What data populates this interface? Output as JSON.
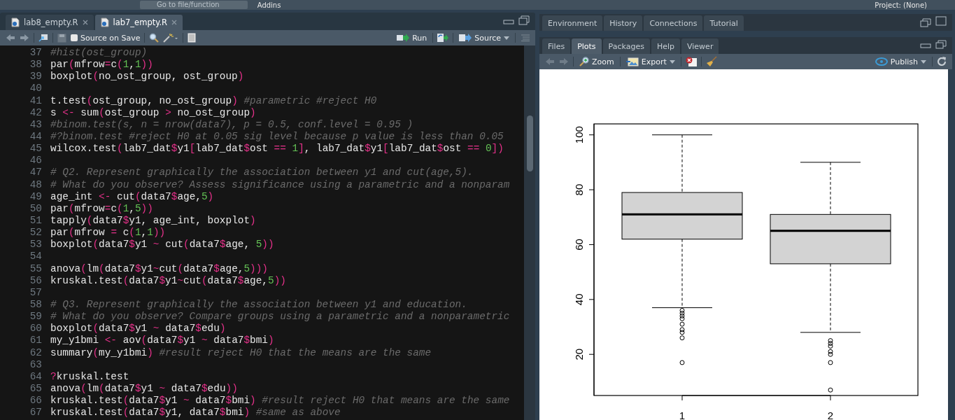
{
  "topbar": {
    "goto_placeholder": "Go to file/function",
    "addins": "Addins",
    "project": "Project: (None)"
  },
  "editor": {
    "tabs": [
      {
        "label": "lab8_empty.R",
        "selected": false
      },
      {
        "label": "lab7_empty.R",
        "selected": true
      }
    ],
    "toolbar": {
      "source_on_save": {
        "label": "Source on Save",
        "checked": false
      },
      "run": "Run",
      "source": "Source"
    },
    "lines": [
      {
        "number": "37",
        "text": "#hist(ost_group)"
      },
      {
        "number": "38",
        "text": "par(mfrow=c(1,1))"
      },
      {
        "number": "39",
        "text": "boxplot(no_ost_group, ost_group)"
      },
      {
        "number": "40"
      },
      {
        "number": "41",
        "text": "t.test(ost_group, no_ost_group) #parametric #reject H0"
      },
      {
        "number": "42",
        "text": "s <- sum(ost_group > no_ost_group)"
      },
      {
        "number": "43",
        "text": "#binom.test(s, n = nrow(data7), p = 0.5, conf.level = 0.95 )"
      },
      {
        "number": "44",
        "text": "#?binom.test #reject H0 at 0.05 sig level because p value is less than 0.05"
      },
      {
        "number": "45",
        "text": "wilcox.test(lab7_dat$y1[lab7_dat$ost == 1], lab7_dat$y1[lab7_dat$ost == 0])"
      },
      {
        "number": "46"
      },
      {
        "number": "47",
        "text": "# Q2. Represent graphically the association between y1 and cut(age,5)."
      },
      {
        "number": "48",
        "text": "# What do you observe? Assess significance using a parametric and a nonparam"
      },
      {
        "number": "49",
        "text": "age_int <- cut(data7$age,5)"
      },
      {
        "number": "50",
        "text": "par(mfrow=c(1,5))"
      },
      {
        "number": "51",
        "text": "tapply(data7$y1, age_int, boxplot)"
      },
      {
        "number": "52",
        "text": "par(mfrow = c(1,1))"
      },
      {
        "number": "53",
        "text": "boxplot(data7$y1 ~ cut(data7$age, 5))"
      },
      {
        "number": "54"
      },
      {
        "number": "55",
        "text": "anova(lm(data7$y1~cut(data7$age,5)))"
      },
      {
        "number": "56",
        "text": "kruskal.test(data7$y1~cut(data7$age,5))"
      },
      {
        "number": "57"
      },
      {
        "number": "58",
        "text": "# Q3. Represent graphically the association between y1 and education."
      },
      {
        "number": "59",
        "text": "# What do you observe? Compare groups using a parametric and a nonparametric"
      },
      {
        "number": "60",
        "text": "boxplot(data7$y1 ~ data7$edu)"
      },
      {
        "number": "61",
        "text": "my_y1bmi <- aov(data7$y1 ~ data7$bmi)"
      },
      {
        "number": "62",
        "text": "summary(my_y1bmi) #result reject H0 that the means are the same"
      },
      {
        "number": "63"
      },
      {
        "number": "64",
        "text": "?kruskal.test"
      },
      {
        "number": "65",
        "text": "anova(lm(data7$y1 ~ data7$edu))"
      },
      {
        "number": "66",
        "text": "kruskal.test(data7$y1 ~ data7$bmi) #result reject H0 that means are the same"
      },
      {
        "number": "67",
        "text": "kruskal.test(data7$y1, data7$bmi) #same as above"
      }
    ]
  },
  "right": {
    "top_tabs": [
      {
        "label": "Environment",
        "selected": false
      },
      {
        "label": "History",
        "selected": false
      },
      {
        "label": "Connections",
        "selected": false
      },
      {
        "label": "Tutorial",
        "selected": false
      }
    ],
    "bottom_tabs": [
      {
        "label": "Files",
        "selected": false
      },
      {
        "label": "Plots",
        "selected": true
      },
      {
        "label": "Packages",
        "selected": false
      },
      {
        "label": "Help",
        "selected": false
      },
      {
        "label": "Viewer",
        "selected": false
      }
    ],
    "toolbar": {
      "zoom": "Zoom",
      "export": "Export",
      "publish": "Publish"
    },
    "plot": {
      "chart_data": {
        "type": "box",
        "categories": [
          "1",
          "2"
        ],
        "ylim": [
          5,
          104
        ],
        "yticks": [
          20,
          40,
          60,
          80,
          100
        ],
        "boxes": [
          {
            "low": 37,
            "q1": 62,
            "median": 71,
            "q3": 79,
            "high": 100,
            "outliers": [
              36,
              35,
              34,
              33,
              31,
              29,
              28,
              26,
              17
            ]
          },
          {
            "low": 28,
            "q1": 53,
            "median": 65,
            "q3": 71,
            "high": 90,
            "outliers": [
              25,
              24,
              23,
              21,
              20,
              17,
              7
            ]
          }
        ]
      }
    }
  }
}
